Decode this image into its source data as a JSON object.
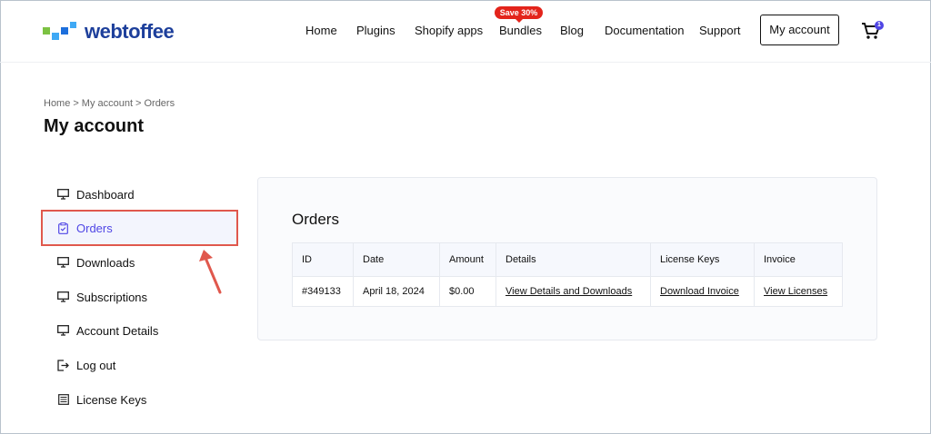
{
  "brand": {
    "name": "webtoffee"
  },
  "nav": {
    "items": [
      "Home",
      "Plugins",
      "Shopify apps",
      "Bundles",
      "Blog",
      "Documentation",
      "Support"
    ],
    "promo_badge": "Save 30%",
    "account_button": "My account",
    "cart_count": "1"
  },
  "breadcrumb": {
    "items": [
      "Home",
      "My account",
      "Orders"
    ],
    "separator": ">"
  },
  "page_title": "My account",
  "sidebar": {
    "items": [
      {
        "label": "Dashboard",
        "icon": "monitor-icon"
      },
      {
        "label": "Orders",
        "icon": "clipboard-check-icon",
        "active": true
      },
      {
        "label": "Downloads",
        "icon": "monitor-icon"
      },
      {
        "label": "Subscriptions",
        "icon": "monitor-icon"
      },
      {
        "label": "Account Details",
        "icon": "monitor-icon"
      },
      {
        "label": "Log out",
        "icon": "logout-icon"
      },
      {
        "label": "License Keys",
        "icon": "key-list-icon"
      }
    ]
  },
  "orders": {
    "title": "Orders",
    "columns": [
      "ID",
      "Date",
      "Amount",
      "Details",
      "License Keys",
      "Invoice"
    ],
    "rows": [
      {
        "id": "#349133",
        "date": "April 18, 2024",
        "amount": "$0.00",
        "details": "View Details and Downloads",
        "license_keys": "Download Invoice",
        "invoice": "View Licenses"
      }
    ]
  },
  "colors": {
    "brand": "#1d3f9b",
    "accent": "#4f46e5",
    "promo": "#e3241b",
    "annotation": "#e0584d"
  }
}
